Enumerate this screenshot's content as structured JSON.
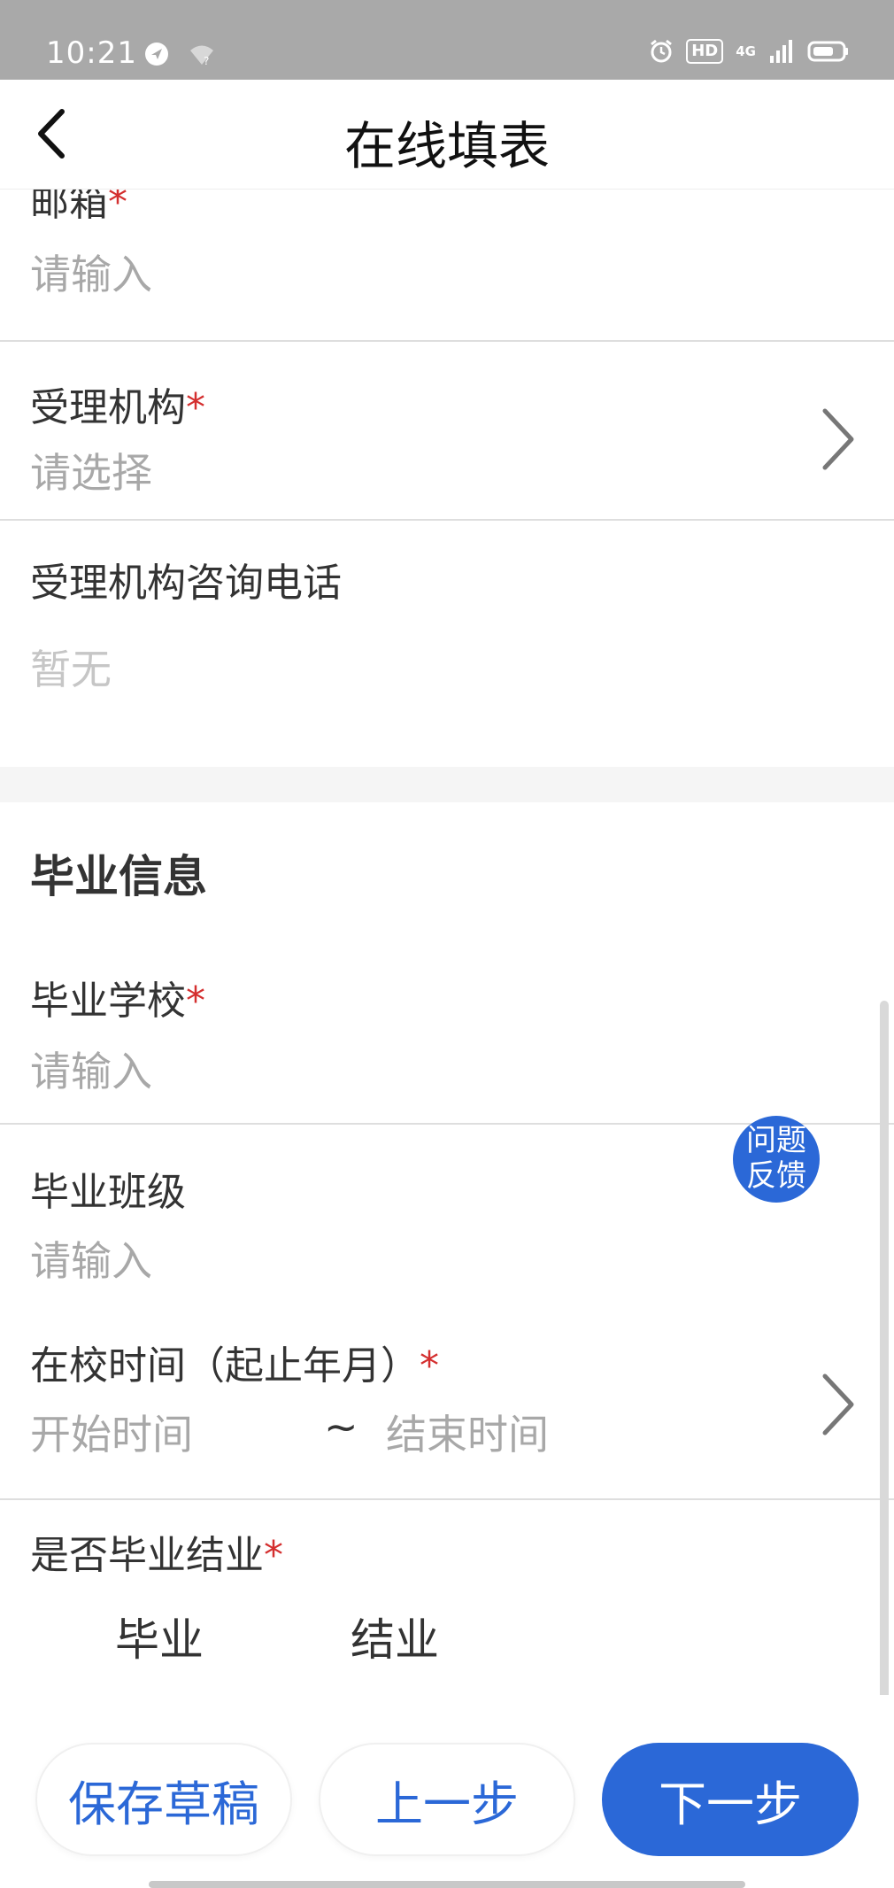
{
  "status_bar": {
    "time": "10:21",
    "network_label": "4G",
    "icons": [
      "location-arrow-icon",
      "wifi-icon",
      "alarm-icon",
      "hd-icon",
      "signal-icon",
      "battery-icon"
    ]
  },
  "nav": {
    "title": "在线填表",
    "back_icon": "chevron-left-icon"
  },
  "contact_section": {
    "postcode": {
      "label": "邮箱",
      "required_mark": "*",
      "placeholder": "请输入"
    },
    "agency": {
      "label": "受理机构",
      "required_mark": "*",
      "placeholder": "请选择"
    },
    "agency_phone": {
      "label": "受理机构咨询电话",
      "value": "暂无"
    }
  },
  "graduation_section": {
    "title": "毕业信息",
    "school": {
      "label": "毕业学校",
      "required_mark": "*",
      "placeholder": "请输入"
    },
    "class": {
      "label": "毕业班级",
      "placeholder": "请输入"
    },
    "period": {
      "label": "在校时间（起止年月）",
      "required_mark": "*",
      "start_placeholder": "开始时间",
      "separator": "~",
      "end_placeholder": "结束时间"
    },
    "status": {
      "label": "是否毕业结业",
      "required_mark": "*",
      "options": [
        "毕业",
        "结业"
      ]
    }
  },
  "feedback": {
    "label_line1": "问题",
    "label_line2": "反馈"
  },
  "actions": {
    "save_draft": "保存草稿",
    "previous": "上一步",
    "next": "下一步"
  },
  "colors": {
    "accent": "#2b68d7",
    "required": "#d42f2f",
    "placeholder": "#a8a8a8",
    "status_bar": "#a9a9a9"
  }
}
